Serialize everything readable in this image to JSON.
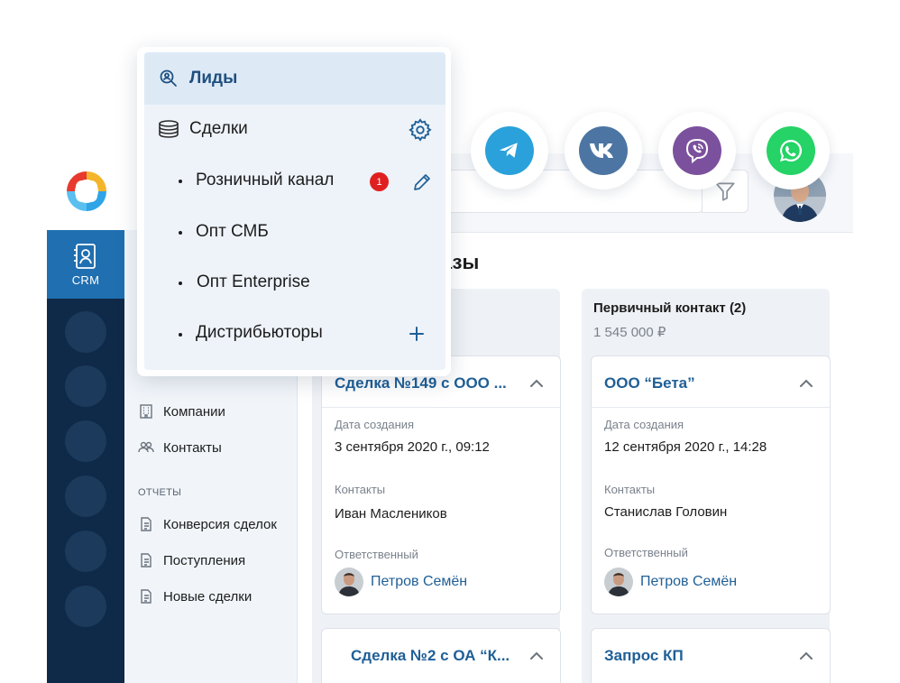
{
  "colors": {
    "rail": "#0f2948",
    "accent": "#1f6fb1",
    "link": "#1f5f96",
    "badge": "#e02020",
    "telegram": "#2aa1da",
    "vk": "#4c75a3",
    "viber": "#7b519d",
    "whatsapp": "#25d366"
  },
  "rail": {
    "crm_label": "CRM",
    "crm_icon": "contact-book-icon",
    "logo_icon": "app-logo-icon"
  },
  "dropdown": {
    "leads": {
      "label": "Лиды",
      "icon": "lead-search-icon"
    },
    "deals": {
      "label": "Сделки",
      "icon": "coins-stack-icon",
      "action_icon": "gear-icon"
    },
    "pipelines": [
      {
        "label": "Розничный канал",
        "badge": "1",
        "action_icon": "pencil-icon"
      },
      {
        "label": "Опт СМБ"
      },
      {
        "label": "Опт Enterprise"
      },
      {
        "label": "Дистрибьюторы",
        "action_icon": "plus-icon"
      }
    ]
  },
  "subnav": {
    "references_items": [
      {
        "label": "Компании",
        "icon": "building-icon"
      },
      {
        "label": "Контакты",
        "icon": "people-icon"
      }
    ],
    "reports_title": "ОТЧЕТЫ",
    "reports_items": [
      {
        "label": "Конверсия сделок",
        "icon": "document-icon"
      },
      {
        "label": "Поступления",
        "icon": "document-icon"
      },
      {
        "label": "Новые сделки",
        "icon": "document-icon"
      }
    ]
  },
  "header": {
    "heading_visible": "казы",
    "filter_icon": "filter-icon"
  },
  "messengers": [
    {
      "name": "telegram",
      "icon": "telegram-icon"
    },
    {
      "name": "vk",
      "icon": "vk-icon"
    },
    {
      "name": "viber",
      "icon": "viber-icon"
    },
    {
      "name": "whatsapp",
      "icon": "whatsapp-icon"
    }
  ],
  "board": {
    "column2": {
      "title": "Первичный контакт (2)",
      "sum": "1 545 000 ₽"
    },
    "cards": {
      "c1": {
        "title": "Сделка №149 с ООО ...",
        "date_label": "Дата создания",
        "date": "3 сентября 2020 г., 09:12",
        "contacts_label": "Контакты",
        "contact": "Иван Маслеников",
        "owner_label": "Ответственный",
        "owner": "Петров Семён"
      },
      "c2": {
        "title": "ООО “Бета”",
        "date_label": "Дата создания",
        "date": "12 сентября 2020 г., 14:28",
        "contacts_label": "Контакты",
        "contact": "Станислав Головин",
        "owner_label": "Ответственный",
        "owner": "Петров Семён"
      },
      "c3": {
        "title": "Сделка №2 с ОА “К..."
      },
      "c4": {
        "title": "Запрос КП"
      }
    }
  }
}
